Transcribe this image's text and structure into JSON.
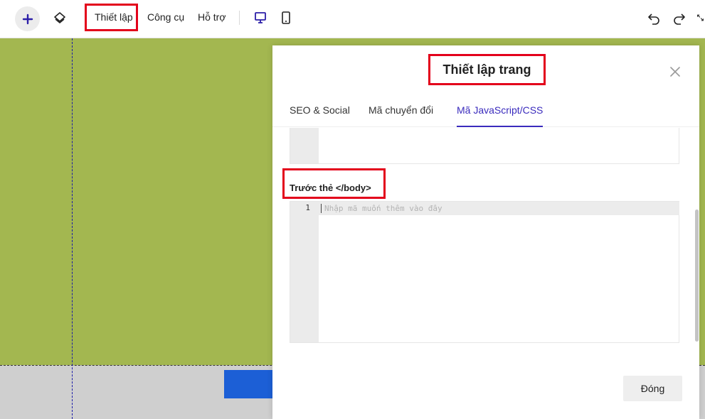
{
  "toolbar": {
    "menu": {
      "setup": "Thiết lập",
      "tools": "Công cụ",
      "support": "Hỗ trợ"
    },
    "icons": {
      "add": "plus-icon",
      "layers": "layers-icon",
      "desktop": "desktop-icon",
      "mobile": "mobile-icon",
      "undo": "undo-icon",
      "redo": "redo-icon",
      "fullscreen": "fullscreen-icon"
    }
  },
  "modal": {
    "title": "Thiết lập trang",
    "tabs": [
      "SEO & Social",
      "Mã chuyển đổi",
      "Mã JavaScript/CSS"
    ],
    "active_tab": "Mã JavaScript/CSS",
    "section_label": "Trước thẻ </body>",
    "editor": {
      "line_number": "1",
      "placeholder": "Nhập mã muốn thêm vào đây"
    },
    "close_button": "Đóng"
  },
  "colors": {
    "canvas_bg": "#a3b750",
    "accent": "#3a2bbd",
    "highlight": "#e3001b",
    "block_blue": "#1c5fd6"
  }
}
